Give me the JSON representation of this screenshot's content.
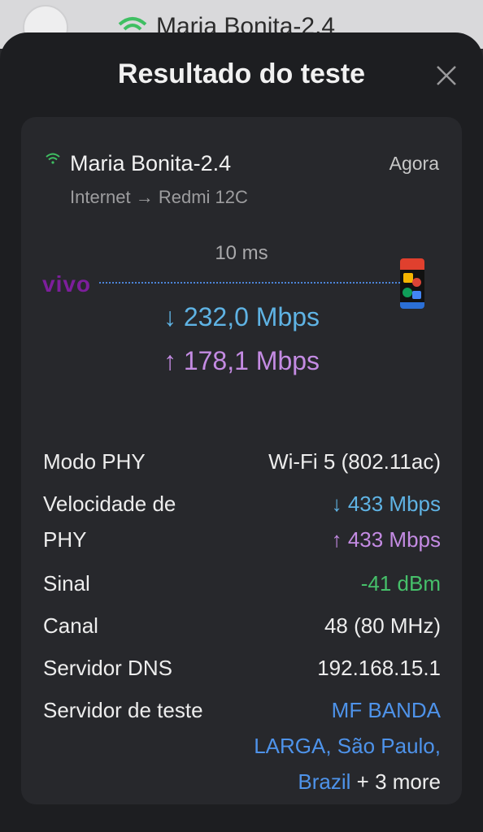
{
  "background": {
    "network_name": "Maria Bonita-2.4"
  },
  "sheet": {
    "title": "Resultado do teste",
    "close_icon": "close-icon"
  },
  "network": {
    "name": "Maria Bonita-2.4",
    "time": "Agora",
    "path_from": "Internet",
    "path_to": "Redmi 12C",
    "wifi_color": "#3fbf62"
  },
  "test": {
    "latency": "10 ms",
    "provider_logo": "vivo",
    "download": "232,0 Mbps",
    "upload": "178,1 Mbps"
  },
  "details": {
    "phy_mode_label": "Modo PHY",
    "phy_mode_value": "Wi-Fi 5 (802.11ac)",
    "phy_speed_label_1": "Velocidade de",
    "phy_speed_label_2": "PHY",
    "phy_speed_down": "433 Mbps",
    "phy_speed_up": "433 Mbps",
    "signal_label": "Sinal",
    "signal_value": "-41 dBm",
    "channel_label": "Canal",
    "channel_value": "48 (80 MHz)",
    "dns_label": "Servidor DNS",
    "dns_value": "192.168.15.1",
    "server_label": "Servidor de teste",
    "server_line_1": "MF BANDA",
    "server_line_2": "LARGA, São Paulo,",
    "server_line_3": "Brazil",
    "server_more": "+ 3 more"
  },
  "colors": {
    "download": "#5fb3e4",
    "upload": "#c48be3",
    "signal": "#46c06a",
    "link": "#4e93ea",
    "provider": "#7d1e9c"
  }
}
